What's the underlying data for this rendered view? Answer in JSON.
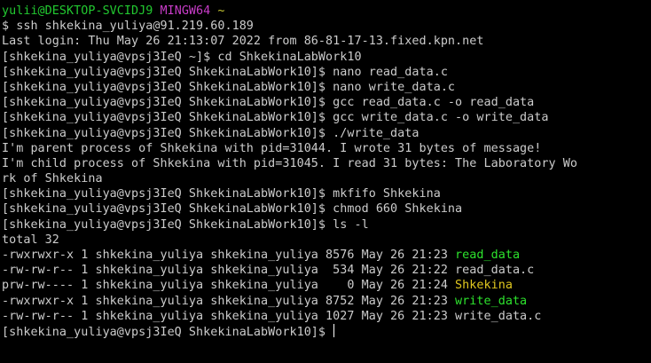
{
  "colors": {
    "background": "#000000",
    "text": "#cccccc",
    "prompt_user": "#22c930",
    "prompt_env": "#c83cc8",
    "prompt_dir": "#c8c832",
    "executable": "#2de32d",
    "fifo": "#e0c71f"
  },
  "prompt": {
    "user_host": "yulii@DESKTOP-SVCIDJ9",
    "env": "MINGW64",
    "dir": "~"
  },
  "lines": {
    "l2": "$ ssh shkekina_yuliya@91.219.60.189",
    "l3": "Last login: Thu May 26 21:13:07 2022 from 86-81-17-13.fixed.kpn.net",
    "l4": "[shkekina_yuliya@vpsj3IeQ ~]$ cd ShkekinaLabWork10",
    "l5": "[shkekina_yuliya@vpsj3IeQ ShkekinaLabWork10]$ nano read_data.c",
    "l6": "[shkekina_yuliya@vpsj3IeQ ShkekinaLabWork10]$ nano write_data.c",
    "l7": "[shkekina_yuliya@vpsj3IeQ ShkekinaLabWork10]$ gcc read_data.c -o read_data",
    "l8": "[shkekina_yuliya@vpsj3IeQ ShkekinaLabWork10]$ gcc write_data.c -o write_data",
    "l9": "[shkekina_yuliya@vpsj3IeQ ShkekinaLabWork10]$ ./write_data",
    "l10": "I'm parent process of Shkekina with pid=31044. I wrote 31 bytes of message!",
    "l11": "I'm child process of Shkekina with pid=31045. I read 31 bytes: The Laboratory Wo",
    "l12": "rk of Shkekina",
    "l13": "[shkekina_yuliya@vpsj3IeQ ShkekinaLabWork10]$ mkfifo Shkekina",
    "l14": "[shkekina_yuliya@vpsj3IeQ ShkekinaLabWork10]$ chmod 660 Shkekina",
    "l15": "[shkekina_yuliya@vpsj3IeQ ShkekinaLabWork10]$ ls -l",
    "l16": "total 32"
  },
  "ls_rows": [
    {
      "meta": "-rwxrwxr-x 1 shkekina_yuliya shkekina_yuliya 8576 May 26 21:23 ",
      "name": "read_data",
      "kind": "exec"
    },
    {
      "meta": "-rw-rw-r-- 1 shkekina_yuliya shkekina_yuliya  534 May 26 21:22 ",
      "name": "read_data.c",
      "kind": "plain"
    },
    {
      "meta": "prw-rw---- 1 shkekina_yuliya shkekina_yuliya    0 May 26 21:24 ",
      "name": "Shkekina",
      "kind": "fifo"
    },
    {
      "meta": "-rwxrwxr-x 1 shkekina_yuliya shkekina_yuliya 8752 May 26 21:23 ",
      "name": "write_data",
      "kind": "exec"
    },
    {
      "meta": "-rw-rw-r-- 1 shkekina_yuliya shkekina_yuliya 1027 May 26 21:23 ",
      "name": "write_data.c",
      "kind": "plain"
    }
  ],
  "final_prompt": "[shkekina_yuliya@vpsj3IeQ ShkekinaLabWork10]$ "
}
